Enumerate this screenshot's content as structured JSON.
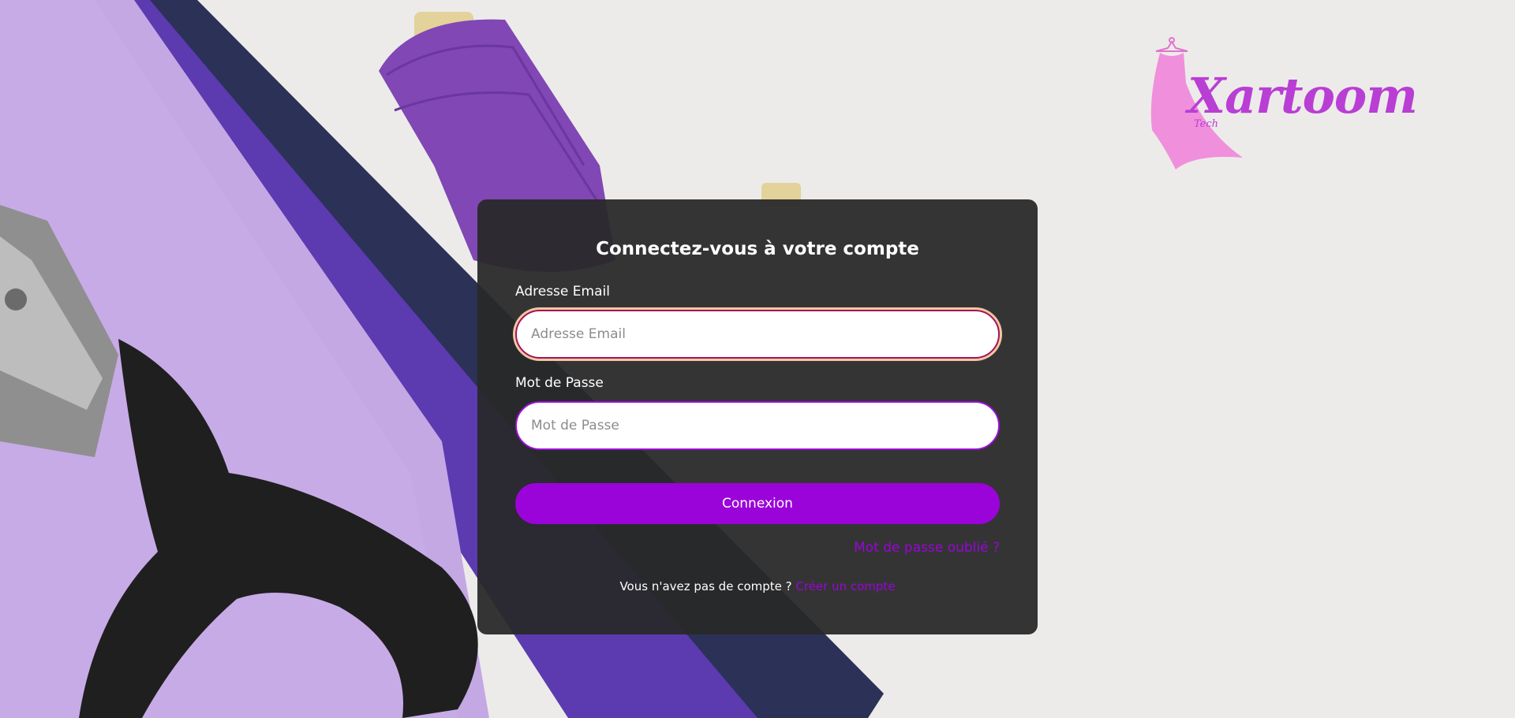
{
  "brand": {
    "name": "Xartoom",
    "tagline": "Tech",
    "logo_icon": "dress-on-hanger-icon",
    "color": "#b93ed4"
  },
  "login": {
    "title": "Connectez-vous à votre compte",
    "email_label": "Adresse Email",
    "email_placeholder": "Adresse Email",
    "email_value": "",
    "password_label": "Mot de Passe",
    "password_placeholder": "Mot de Passe",
    "password_value": "",
    "submit_label": "Connexion",
    "forgot_label": "Mot de passe oublié ?",
    "no_account_text": "Vous n'avez pas de compte ?",
    "signup_link": "Créer un compte"
  },
  "colors": {
    "accent": "#9a04d9",
    "card_background": "#282828",
    "page_background": "#ecebe9"
  },
  "background_image": "sewing-scissors-fabric-thread-photo"
}
